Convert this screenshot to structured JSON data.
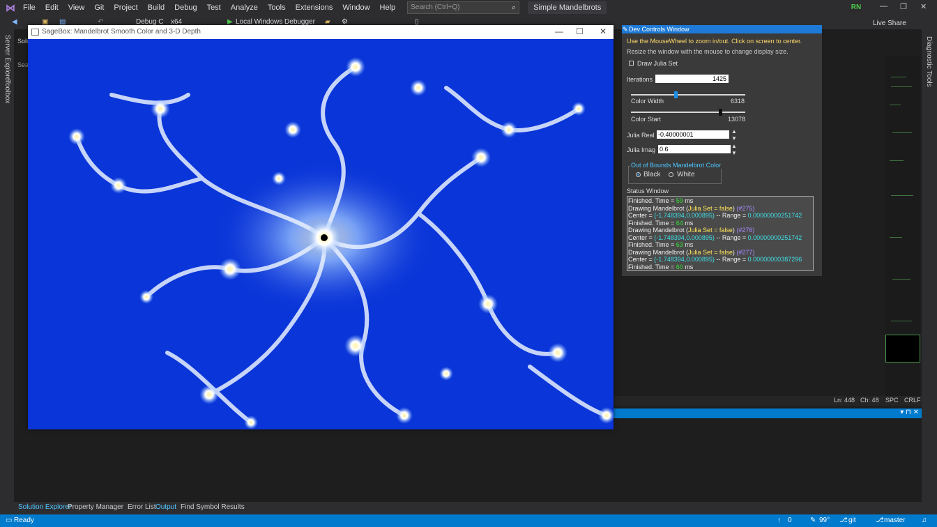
{
  "menubar": {
    "items": [
      "File",
      "Edit",
      "View",
      "Git",
      "Project",
      "Build",
      "Debug",
      "Test",
      "Analyze",
      "Tools",
      "Extensions",
      "Window",
      "Help"
    ],
    "search_placeholder": "Search (Ctrl+Q)",
    "solution_name": "Simple Mandelbrots",
    "user_initials": "RN"
  },
  "toolbar": {
    "config": "Debug C",
    "platform": "x64",
    "run_label": "Local Windows Debugger",
    "live_share": "Live Share"
  },
  "side_panels": {
    "left": [
      "Server Explorer",
      "Toolbox"
    ],
    "right": "Diagnostic Tools",
    "solution_stub": "Solu",
    "search_stub": "Sear"
  },
  "sagebox_window": {
    "title": "SageBox: Mandelbrot Smooth Color and 3-D Depth"
  },
  "dev_controls": {
    "title": "Dev Controls Window",
    "instruction_1": "Use the MouseWheel to zoom in/out. Click on screen to center.",
    "instruction_2": "Resize the window with the mouse to change display size.",
    "draw_julia_label": "Draw Julia Set",
    "draw_julia_checked": false,
    "iterations_label": "Iterations",
    "iterations_value": "1425",
    "color_width_label": "Color Width",
    "color_width_value": "6318",
    "color_width_level": 0.39,
    "color_start_label": "Color Start",
    "color_start_value": "13078",
    "color_start_level": 0.78,
    "julia_real_label": "Julia Real",
    "julia_real_value": "-0.40000001",
    "julia_imag_label": "Julia Imag",
    "julia_imag_value": "0.6",
    "oob_legend": "Out of Bounds Mandelbrot Color",
    "oob_black": "Black",
    "oob_white": "White",
    "oob_selected": "Black",
    "status_title": "Status Window",
    "status_lines": [
      [
        [
          "Finished. Time = ",
          "w"
        ],
        [
          "59",
          "g"
        ],
        [
          " ms",
          "w"
        ]
      ],
      [
        [
          "Drawing Mandelbrot (",
          "w"
        ],
        [
          "Julia Set = false",
          "y"
        ],
        [
          ") ",
          "w"
        ],
        [
          "(#275)",
          "p"
        ]
      ],
      [
        [
          "Center = ",
          "w"
        ],
        [
          "(-1.748394,0.000895)",
          "c"
        ],
        [
          " -- Range = ",
          "w"
        ],
        [
          "0.00000000251742",
          "c"
        ]
      ],
      [
        [
          "Finished. Time = ",
          "w"
        ],
        [
          "64",
          "g"
        ],
        [
          " ms",
          "w"
        ]
      ],
      [
        [
          "Drawing Mandelbrot (",
          "w"
        ],
        [
          "Julia Set = false",
          "y"
        ],
        [
          ") ",
          "w"
        ],
        [
          "(#276)",
          "p"
        ]
      ],
      [
        [
          "Center = ",
          "w"
        ],
        [
          "(-1.748394,0.000895)",
          "c"
        ],
        [
          " -- Range = ",
          "w"
        ],
        [
          "0.00000000251742",
          "c"
        ]
      ],
      [
        [
          "Finished. Time = ",
          "w"
        ],
        [
          "63",
          "g"
        ],
        [
          " ms",
          "w"
        ]
      ],
      [
        [
          "Drawing Mandelbrot (",
          "w"
        ],
        [
          "Julia Set = false",
          "y"
        ],
        [
          ") ",
          "w"
        ],
        [
          "(#277)",
          "p"
        ]
      ],
      [
        [
          "Center = ",
          "w"
        ],
        [
          "(-1.748394,0.000895)",
          "c"
        ],
        [
          " -- Range = ",
          "w"
        ],
        [
          "0.00000000387296",
          "c"
        ]
      ],
      [
        [
          "Finished. Time = ",
          "w"
        ],
        [
          "60",
          "g"
        ],
        [
          " ms",
          "w"
        ]
      ]
    ]
  },
  "editor_status": {
    "line": "Ln: 448",
    "col": "Ch: 48",
    "spacing": "SPC",
    "eol": "CRLF"
  },
  "bottom_tabs": [
    "Solution Explorer",
    "Property Manager",
    "Error List",
    "Output",
    "Find Symbol Results"
  ],
  "statusbar": {
    "ready": "Ready",
    "errors": "0",
    "percent": "99°",
    "git": "git",
    "branch": "master"
  },
  "colors": {
    "accent": "#007acc",
    "fractal_blue": "#0a35d8",
    "dev_title": "#1e7ad6"
  }
}
